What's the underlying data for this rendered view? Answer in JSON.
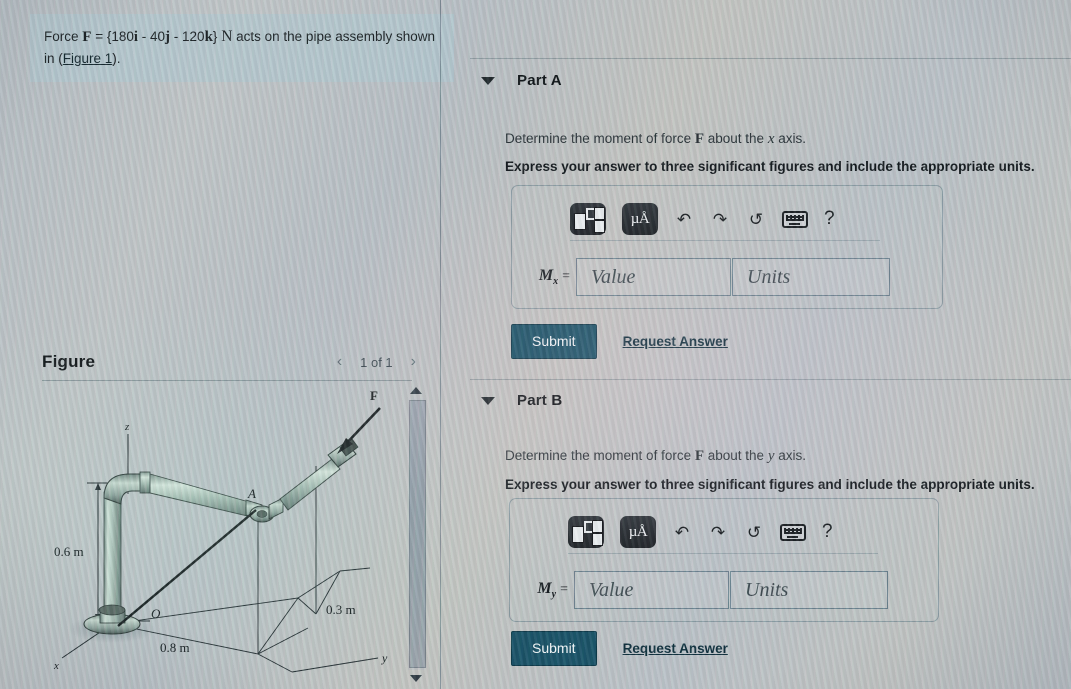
{
  "problem": {
    "prefix": "Force ",
    "force_symbol": "F",
    "equals": " = {180",
    "i_sym": "i",
    "mid1": " - 40",
    "j_sym": "j",
    "mid2": " - 120",
    "k_sym": "k",
    "suffix": "} ",
    "unit": "N",
    "tail": " acts on the pipe assembly shown in (",
    "figure_link": "Figure 1",
    "end": ")."
  },
  "figure_panel": {
    "title": "Figure",
    "pager": {
      "prev_icon": "chevron-left-icon",
      "prev_glyph": "‹",
      "counter": "1 of 1",
      "next_icon": "chevron-right-icon",
      "next_glyph": "›"
    },
    "scrollbar": {
      "up_icon": "scroll-up-arrow-icon",
      "down_icon": "scroll-down-arrow-icon"
    },
    "diagram": {
      "axis_z": "z",
      "axis_x": "x",
      "axis_y": "y",
      "point_o": "O",
      "point_a": "A",
      "force_label": "F",
      "dim_height": "0.6 m",
      "dim_x": "0.8 m",
      "dim_y": "0.3 m"
    }
  },
  "parts": [
    {
      "id": "part-a",
      "label": "Part A",
      "caret_icon": "caret-down-icon",
      "prompt_pre": "Determine the moment of force ",
      "prompt_force": "F",
      "prompt_mid": " about the ",
      "prompt_axis": "x",
      "prompt_post": " axis.",
      "instruction": "Express your answer to three significant figures and include the appropriate units.",
      "toolbar": {
        "template_icon": "math-template-icon",
        "units_icon": "units-micro-angstrom-icon",
        "units_label": "µÅ",
        "undo_icon": "undo-icon",
        "undo_glyph": "↶",
        "redo_icon": "redo-icon",
        "redo_glyph": "↷",
        "reset_icon": "reset-icon",
        "reset_glyph": "↺",
        "keyboard_icon": "keyboard-icon",
        "help_icon": "help-question-icon",
        "help_glyph": "?"
      },
      "answer_label": "M",
      "answer_subscript": "x",
      "answer_equals": "=",
      "value_placeholder": "Value",
      "units_placeholder": "Units",
      "submit_label": "Submit",
      "request_label": "Request Answer"
    },
    {
      "id": "part-b",
      "label": "Part B",
      "caret_icon": "caret-down-icon",
      "prompt_pre": "Determine the moment of force ",
      "prompt_force": "F",
      "prompt_mid": " about the ",
      "prompt_axis": "y",
      "prompt_post": " axis.",
      "instruction": "Express your answer to three significant figures and include the appropriate units.",
      "toolbar": {
        "template_icon": "math-template-icon",
        "units_icon": "units-micro-angstrom-icon",
        "units_label": "µÅ",
        "undo_icon": "undo-icon",
        "undo_glyph": "↶",
        "redo_icon": "redo-icon",
        "redo_glyph": "↷",
        "reset_icon": "reset-icon",
        "reset_glyph": "↺",
        "keyboard_icon": "keyboard-icon",
        "help_icon": "help-question-icon",
        "help_glyph": "?"
      },
      "answer_label": "M",
      "answer_subscript": "y",
      "answer_equals": "=",
      "value_placeholder": "Value",
      "units_placeholder": "Units",
      "submit_label": "Submit",
      "request_label": "Request Answer"
    }
  ],
  "colors": {
    "submit_bg": "#1b5266",
    "link": "#10303d",
    "panel_bg": "#b0c6ce",
    "page_bg": "#b9c0c4"
  }
}
